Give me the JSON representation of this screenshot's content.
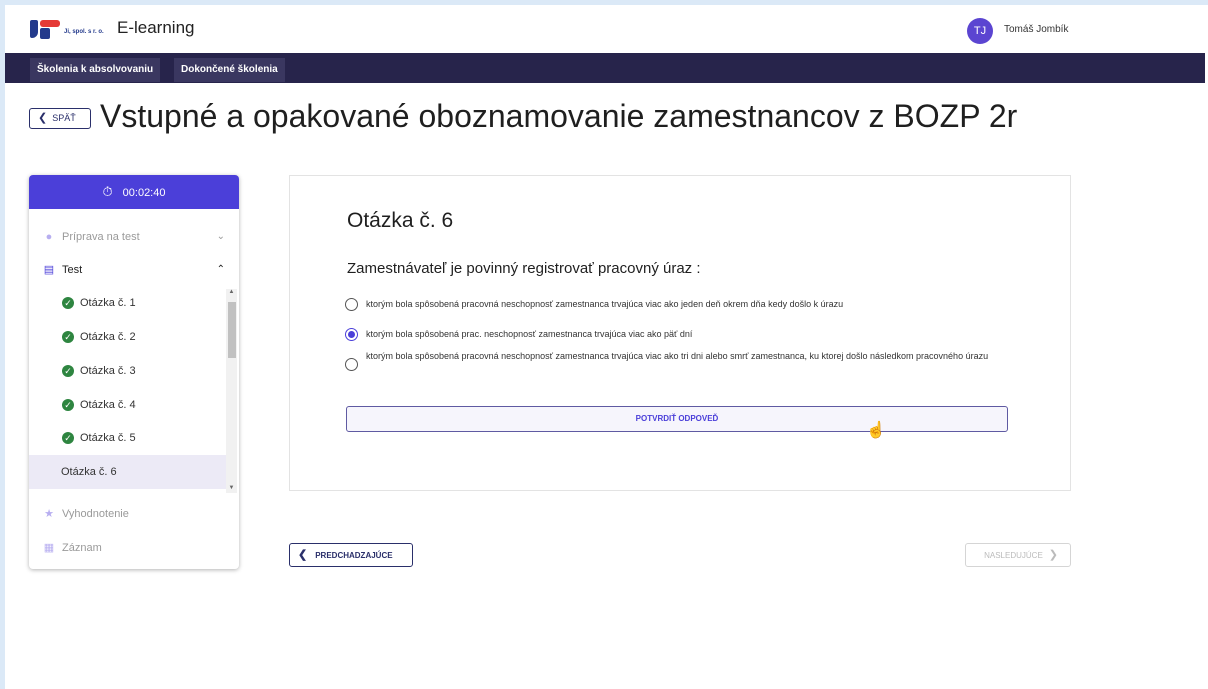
{
  "header": {
    "logo_text": "Ji, spol. s r. o.",
    "app_title": "E-learning",
    "user_initials": "TJ",
    "user_name": "Tomáš Jombík"
  },
  "nav": {
    "tabs": [
      {
        "label": "Školenia k absolvovaniu"
      },
      {
        "label": "Dokončené školenia"
      }
    ]
  },
  "page": {
    "back_label": "SPÄŤ",
    "title": "Vstupné a opakované oboznamovanie zamestnancov z BOZP 2r"
  },
  "sidebar": {
    "timer": "00:02:40",
    "sections": [
      {
        "label": "Príprava na test",
        "icon": "lightbulb-icon"
      },
      {
        "label": "Test",
        "icon": "document-icon"
      },
      {
        "label": "Vyhodnotenie",
        "icon": "star-icon"
      },
      {
        "label": "Záznam",
        "icon": "book-icon"
      }
    ],
    "questions": [
      {
        "label": "Otázka č. 1",
        "done": true
      },
      {
        "label": "Otázka č. 2",
        "done": true
      },
      {
        "label": "Otázka č. 3",
        "done": true
      },
      {
        "label": "Otázka č. 4",
        "done": true
      },
      {
        "label": "Otázka č. 5",
        "done": true
      },
      {
        "label": "Otázka č. 6",
        "done": false
      }
    ]
  },
  "question": {
    "title": "Otázka č. 6",
    "text": "Zamestnávateľ je povinný registrovať pracovný úraz :",
    "options": [
      {
        "text": "ktorým bola spôsobená pracovná neschopnosť zamestnanca trvajúca viac ako jeden deň okrem dňa kedy došlo k úrazu",
        "selected": false
      },
      {
        "text": "ktorým bola spôsobená prac. neschopnosť zamestnanca trvajúca viac ako päť dní",
        "selected": true
      },
      {
        "text": "ktorým bola spôsobená pracovná neschopnosť zamestnanca trvajúca viac ako tri dni alebo smrť zamestnanca, ku ktorej došlo následkom pracovného úrazu",
        "selected": false
      }
    ],
    "confirm_label": "POTVRDIŤ ODPOVEĎ"
  },
  "pager": {
    "prev_label": "PREDCHADZAJÚCE",
    "next_label": "NASLEDUJÚCE"
  },
  "colors": {
    "accent": "#4b3fd9",
    "navbar": "#27244b",
    "success": "#2e8540"
  }
}
